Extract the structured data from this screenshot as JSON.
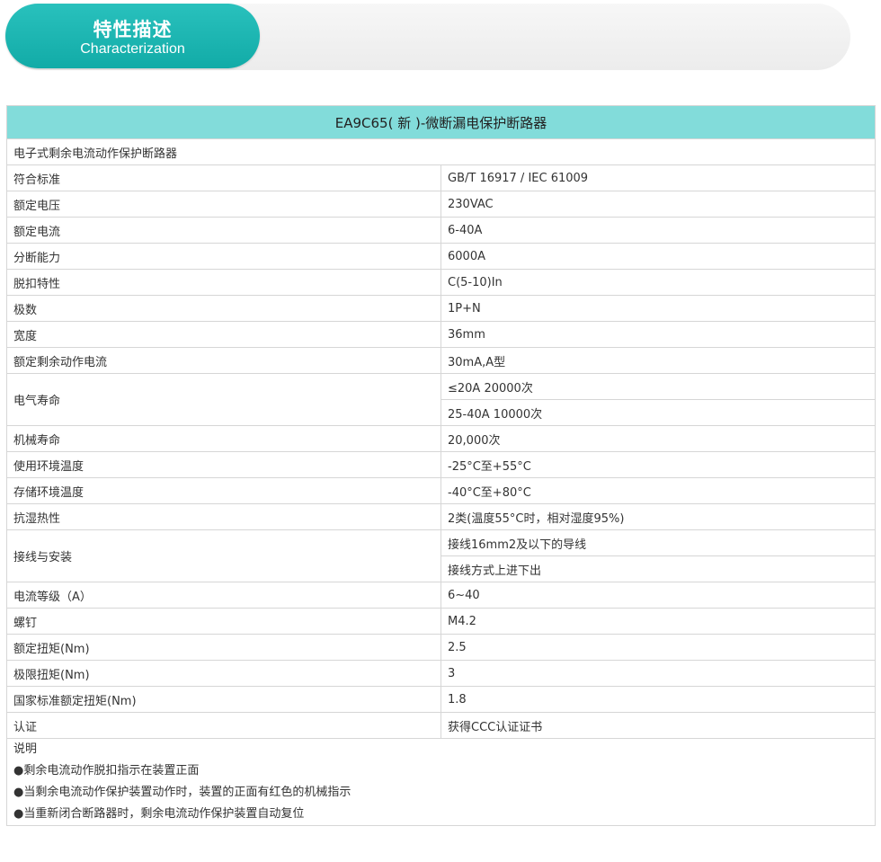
{
  "banner": {
    "title_cn": "特性描述",
    "title_en": "Characterization"
  },
  "table": {
    "title": "EA9C65( 新 )-微断漏电保护断路器",
    "subtitle": "电子式剩余电流动作保护断路器",
    "rows": [
      {
        "label": "符合标准",
        "values": [
          "GB/T 16917 / IEC 61009"
        ]
      },
      {
        "label": "额定电压",
        "values": [
          "230VAC"
        ]
      },
      {
        "label": "额定电流",
        "values": [
          "6-40A"
        ]
      },
      {
        "label": "分断能力",
        "values": [
          "6000A"
        ]
      },
      {
        "label": "脱扣特性",
        "values": [
          "C(5-10)In"
        ]
      },
      {
        "label": "极数",
        "values": [
          "1P+N"
        ]
      },
      {
        "label": "宽度",
        "values": [
          "36mm"
        ]
      },
      {
        "label": "额定剩余动作电流",
        "values": [
          "30mA,A型"
        ]
      },
      {
        "label": "电气寿命",
        "values": [
          "≤20A 20000次",
          "25-40A 10000次"
        ]
      },
      {
        "label": "机械寿命",
        "values": [
          "20,000次"
        ]
      },
      {
        "label": "使用环境温度",
        "values": [
          "-25°C至+55°C"
        ]
      },
      {
        "label": "存储环境温度",
        "values": [
          "-40°C至+80°C"
        ]
      },
      {
        "label": "抗湿热性",
        "values": [
          "2类(温度55°C时，相对湿度95%)"
        ]
      },
      {
        "label": "接线与安装",
        "values": [
          "接线16mm2及以下的导线",
          "接线方式上进下出"
        ]
      },
      {
        "label": "电流等级（A）",
        "values": [
          "6~40"
        ]
      },
      {
        "label": "螺钉",
        "values": [
          "M4.2"
        ]
      },
      {
        "label": "额定扭矩(Nm)",
        "values": [
          "2.5"
        ]
      },
      {
        "label": "极限扭矩(Nm)",
        "values": [
          "3"
        ]
      },
      {
        "label": "国家标准额定扭矩(Nm)",
        "values": [
          "1.8"
        ]
      },
      {
        "label": "认证",
        "values": [
          "获得CCC认证证书"
        ]
      }
    ],
    "notes": [
      "说明",
      "●剩余电流动作脱扣指示在装置正面",
      "●当剩余电流动作保护装置动作时，装置的正面有红色的机械指示",
      "●当重新闭合断路器时，剩余电流动作保护装置自动复位"
    ]
  }
}
